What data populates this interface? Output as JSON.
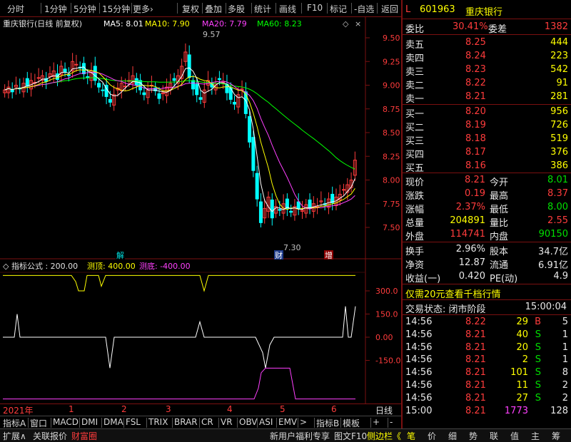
{
  "toolbar": {
    "items": [
      "分时",
      "1分钟",
      "5分钟",
      "15分钟",
      "更多›",
      "复权",
      "叠加",
      "多股",
      "统计",
      "画线",
      "F10",
      "标记",
      "-自选",
      "返回"
    ]
  },
  "main_chart": {
    "title": "重庆银行(日线 前复权)",
    "ma5": "MA5: 8.01",
    "ma10": "MA10: 7.90",
    "ma20": "MA20: 7.79",
    "ma60": "MA60: 8.23",
    "high_marker": "9.57",
    "low_marker": "7.30",
    "tick_labels": [
      "9.50",
      "9.25",
      "9.00",
      "8.75",
      "8.50",
      "8.25",
      "8.00",
      "7.75",
      "7.50"
    ],
    "event_labels": [
      "解",
      "财",
      "增"
    ],
    "colors": {
      "ma5": "#ffffff",
      "ma10": "#ffff00",
      "ma20": "#ff40ff",
      "ma60": "#00ff00",
      "up": "#ff3c3c",
      "down": "#00ffff"
    }
  },
  "sub_chart": {
    "title": "指标公式 : 200.00",
    "label_top": "测顶: 400.00",
    "label_bottom": "测底: -400.00",
    "tick_labels": [
      "300.0",
      "150.0",
      "0.00",
      "-150.0"
    ]
  },
  "date_row": {
    "year": "2021年",
    "months": [
      "1",
      "2",
      "3",
      "4",
      "5",
      "6"
    ],
    "period": "日线"
  },
  "tabs": [
    "指标A",
    "窗口",
    "MACD",
    "DMI",
    "DMA",
    "FSL",
    "TRIX",
    "BRAR",
    "CR",
    "VR",
    "OBV",
    "ASI",
    "EMV",
    ">",
    "指标B",
    "模板",
    "+",
    "-"
  ],
  "status_left": [
    "扩展∧",
    "关联报价",
    "财富圈"
  ],
  "status_mid": [
    "新用户福利专享",
    "图文F10",
    "侧边栏《"
  ],
  "status_right": [
    "笔",
    "价",
    "细",
    "势",
    "联",
    "值",
    "主",
    "筹"
  ],
  "stock": {
    "prefix": "L",
    "code": "601963",
    "name": "重庆银行"
  },
  "order_ratio": {
    "label1": "委比",
    "value1": "30.41%",
    "label2": "委差",
    "value2": "1382"
  },
  "asks": [
    {
      "label": "卖五",
      "price": "8.25",
      "vol": "444"
    },
    {
      "label": "卖四",
      "price": "8.24",
      "vol": "223"
    },
    {
      "label": "卖三",
      "price": "8.23",
      "vol": "542"
    },
    {
      "label": "卖二",
      "price": "8.22",
      "vol": "91"
    },
    {
      "label": "卖一",
      "price": "8.21",
      "vol": "281"
    }
  ],
  "bids": [
    {
      "label": "买一",
      "price": "8.20",
      "vol": "956"
    },
    {
      "label": "买二",
      "price": "8.19",
      "vol": "726"
    },
    {
      "label": "买三",
      "price": "8.18",
      "vol": "519"
    },
    {
      "label": "买四",
      "price": "8.17",
      "vol": "376"
    },
    {
      "label": "买五",
      "price": "8.16",
      "vol": "386"
    }
  ],
  "quote": [
    {
      "l1": "现价",
      "v1": "8.21",
      "c1": "red",
      "l2": "今开",
      "v2": "8.01",
      "c2": "green"
    },
    {
      "l1": "涨跌",
      "v1": "0.19",
      "c1": "red",
      "l2": "最高",
      "v2": "8.37",
      "c2": "red"
    },
    {
      "l1": "涨幅",
      "v1": "2.37%",
      "c1": "red",
      "l2": "最低",
      "v2": "8.00",
      "c2": "green"
    },
    {
      "l1": "总量",
      "v1": "204891",
      "c1": "yellow",
      "l2": "量比",
      "v2": "2.55",
      "c2": "red"
    },
    {
      "l1": "外盘",
      "v1": "114741",
      "c1": "red",
      "l2": "内盘",
      "v2": "90150",
      "c2": "green"
    }
  ],
  "stats": [
    {
      "l1": "换手",
      "v1": "2.96%",
      "l2": "股本",
      "v2": "34.7亿"
    },
    {
      "l1": "净资",
      "v1": "12.87",
      "l2": "流通",
      "v2": "6.91亿"
    },
    {
      "l1": "收益(一)",
      "v1": "0.420",
      "l2": "PE(动)",
      "v2": "4.9"
    }
  ],
  "promo": "仅需20元查看千档行情",
  "trade_status": {
    "label": "交易状态: 闭市阶段",
    "time": "15:00:04"
  },
  "ticks": [
    {
      "t": "14:56",
      "p": "8.22",
      "v": "29",
      "s": "B",
      "n": "5",
      "vc": "yellow",
      "sc": "red"
    },
    {
      "t": "14:56",
      "p": "8.21",
      "v": "40",
      "s": "S",
      "n": "1",
      "vc": "yellow",
      "sc": "green"
    },
    {
      "t": "14:56",
      "p": "8.21",
      "v": "20",
      "s": "S",
      "n": "1",
      "vc": "yellow",
      "sc": "green"
    },
    {
      "t": "14:56",
      "p": "8.21",
      "v": "2",
      "s": "S",
      "n": "1",
      "vc": "yellow",
      "sc": "green"
    },
    {
      "t": "14:56",
      "p": "8.21",
      "v": "101",
      "s": "S",
      "n": "8",
      "vc": "yellow",
      "sc": "green"
    },
    {
      "t": "14:56",
      "p": "8.21",
      "v": "11",
      "s": "S",
      "n": "2",
      "vc": "yellow",
      "sc": "green"
    },
    {
      "t": "14:56",
      "p": "8.21",
      "v": "27",
      "s": "S",
      "n": "2",
      "vc": "yellow",
      "sc": "green"
    },
    {
      "t": "15:00",
      "p": "8.21",
      "v": "1773",
      "s": "",
      "n": "128",
      "vc": "magenta",
      "sc": "white"
    }
  ]
}
